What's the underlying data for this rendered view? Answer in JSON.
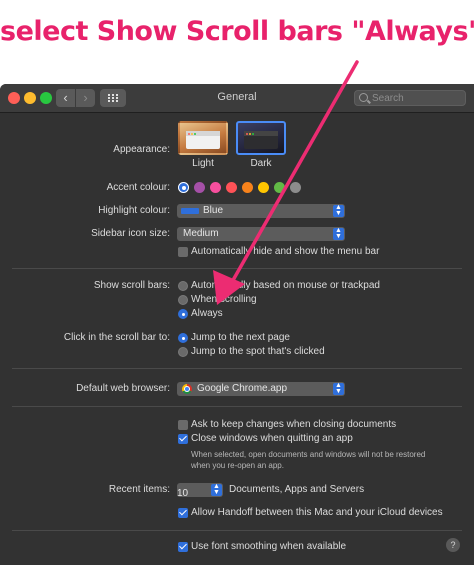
{
  "annotation": {
    "text": "select Show Scroll bars \"Always\"",
    "color": "#e8226b"
  },
  "window": {
    "title": "General",
    "search_placeholder": "Search",
    "nav": {
      "back": "‹",
      "forward": "›"
    }
  },
  "appearance": {
    "label": "Appearance:",
    "options": [
      {
        "name": "Light",
        "selected": false
      },
      {
        "name": "Dark",
        "selected": true
      }
    ]
  },
  "accent_colour": {
    "label": "Accent colour:",
    "swatches": [
      "#2f6fdb",
      "#a550a7",
      "#f74f9e",
      "#ff5257",
      "#f7821b",
      "#ffc600",
      "#62ba46",
      "#8c8c8c"
    ],
    "selected_index": 0
  },
  "highlight_colour": {
    "label": "Highlight colour:",
    "value": "Blue",
    "swatch": "#2f6fdb"
  },
  "sidebar_icon_size": {
    "label": "Sidebar icon size:",
    "value": "Medium"
  },
  "auto_hide_menu_bar": {
    "label": "Automatically hide and show the menu bar",
    "checked": false
  },
  "show_scroll_bars": {
    "label": "Show scroll bars:",
    "options": [
      {
        "label": "Automatically based on mouse or trackpad",
        "selected": false
      },
      {
        "label": "When scrolling",
        "selected": false
      },
      {
        "label": "Always",
        "selected": true
      }
    ]
  },
  "scroll_bar_click": {
    "label": "Click in the scroll bar to:",
    "options": [
      {
        "label": "Jump to the next page",
        "selected": true
      },
      {
        "label": "Jump to the spot that's clicked",
        "selected": false
      }
    ]
  },
  "default_browser": {
    "label": "Default web browser:",
    "value": "Google Chrome.app"
  },
  "documents": {
    "ask_to_keep": {
      "label": "Ask to keep changes when closing documents",
      "checked": false
    },
    "close_windows": {
      "label": "Close windows when quitting an app",
      "checked": true
    },
    "note_line1": "When selected, open documents and windows will not be restored",
    "note_line2": "when you re-open an app."
  },
  "recent_items": {
    "label": "Recent items:",
    "value": "10",
    "suffix": "Documents, Apps and Servers"
  },
  "handoff": {
    "label": "Allow Handoff between this Mac and your iCloud devices",
    "checked": true
  },
  "font_smoothing": {
    "label": "Use font smoothing when available",
    "checked": true
  },
  "help": {
    "label": "?"
  },
  "icons": [
    "search-icon",
    "chrome-icon",
    "grid-icon",
    "help-icon",
    "arrow-icon"
  ]
}
